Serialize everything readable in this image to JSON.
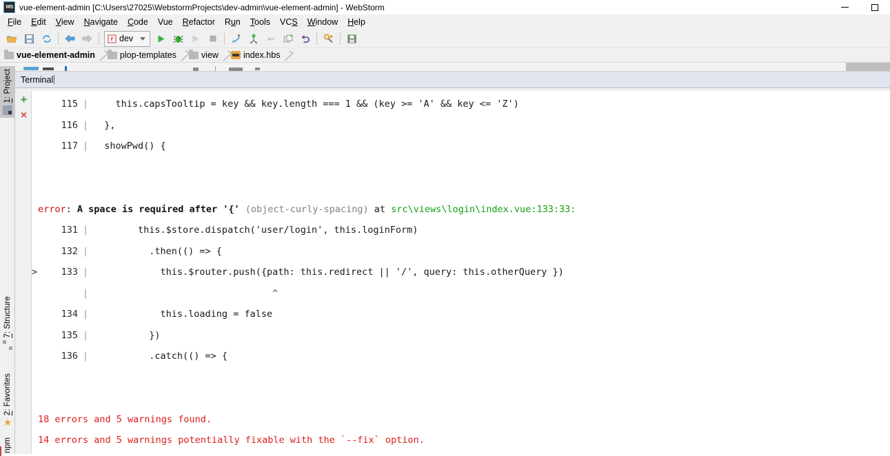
{
  "window": {
    "app_icon": "WS",
    "title": "vue-element-admin [C:\\Users\\27025\\WebstormProjects\\dev-admin\\vue-element-admin] - WebStorm",
    "controls": {
      "minimize": "minimize-button",
      "maximize": "maximize-button"
    }
  },
  "menubar": [
    {
      "label": "File",
      "mnemonic": "F"
    },
    {
      "label": "Edit",
      "mnemonic": "E"
    },
    {
      "label": "View",
      "mnemonic": "V"
    },
    {
      "label": "Navigate",
      "mnemonic": "N"
    },
    {
      "label": "Code",
      "mnemonic": "C"
    },
    {
      "label": "Vue",
      "mnemonic": ""
    },
    {
      "label": "Refactor",
      "mnemonic": "R"
    },
    {
      "label": "Run",
      "mnemonic": "u"
    },
    {
      "label": "Tools",
      "mnemonic": "T"
    },
    {
      "label": "VCS",
      "mnemonic": "S"
    },
    {
      "label": "Window",
      "mnemonic": "W"
    },
    {
      "label": "Help",
      "mnemonic": "H"
    }
  ],
  "toolbar": {
    "buttons": [
      "open-folder-icon",
      "save-all-icon",
      "synchronize-icon",
      "navigate-back-icon",
      "navigate-forward-icon"
    ],
    "run_config": {
      "name": "dev",
      "icon": "npm-icon",
      "dropdown": "chevron-down-icon"
    },
    "run_buttons": [
      "run-icon",
      "debug-icon",
      "coverage-icon",
      "stop-icon"
    ],
    "vcs_buttons": [
      "update-project-icon",
      "commit-icon",
      "push-icon",
      "compare-icon",
      "undo-icon"
    ],
    "right_buttons": [
      "settings-icon",
      "save-all-disk-icon"
    ]
  },
  "breadcrumb": [
    {
      "label": "vue-element-admin",
      "icon": "folder-icon"
    },
    {
      "label": "plop-templates",
      "icon": "folder-icon"
    },
    {
      "label": "view",
      "icon": "folder-icon"
    },
    {
      "label": "index.hbs",
      "icon": "handlebars-file-icon"
    }
  ],
  "tool_window": {
    "title": "Terminal"
  },
  "left_rail": [
    {
      "label": "1: Project",
      "mnemonic": "1",
      "icon": "project-icon",
      "active": true
    },
    {
      "label": "7: Structure",
      "mnemonic": "7",
      "icon": "structure-icon",
      "active": false
    },
    {
      "label": "2: Favorites",
      "mnemonic": "2",
      "icon": "star-icon",
      "active": false
    },
    {
      "label": "npm",
      "mnemonic": "",
      "icon": "npm-rail-icon",
      "active": false
    }
  ],
  "terminal_side_buttons": [
    {
      "name": "new-session-button",
      "glyph": "+"
    },
    {
      "name": "close-session-button",
      "glyph": "×"
    }
  ],
  "terminal": {
    "top_lines": [
      {
        "num": "115",
        "marker": "",
        "text": "    this.capsTooltip = key && key.length === 1 && (key >= 'A' && key <= 'Z')"
      },
      {
        "num": "116",
        "marker": "",
        "text": "  },"
      },
      {
        "num": "117",
        "marker": "",
        "text": "  showPwd() {"
      }
    ],
    "error": {
      "severity": "error",
      "colon": ":",
      "message": "A space is required after '{'",
      "rule": "(object-curly-spacing)",
      "at": "at",
      "path": "src\\views\\login\\index.vue:133:33:"
    },
    "error_lines": [
      {
        "num": "131",
        "marker": "",
        "text": "        this.$store.dispatch('user/login', this.loginForm)"
      },
      {
        "num": "132",
        "marker": "",
        "text": "          .then(() => {"
      },
      {
        "num": "133",
        "marker": ">",
        "text": "            this.$router.push({path: this.redirect || '/', query: this.otherQuery })"
      },
      {
        "num": "",
        "marker": "",
        "text": "                                ^"
      },
      {
        "num": "134",
        "marker": "",
        "text": "            this.loading = false"
      },
      {
        "num": "135",
        "marker": "",
        "text": "          })"
      },
      {
        "num": "136",
        "marker": "",
        "text": "          .catch(() => {"
      }
    ],
    "summary": [
      "18 errors and 5 warnings found.",
      "14 errors and 5 warnings potentially fixable with the `--fix` option."
    ]
  },
  "colors": {
    "error_red": "#cc1111",
    "summary_red": "#e01b1b",
    "path_green": "#12a112",
    "rule_gray": "#808080",
    "toolwindow_header": "#e1e5ee",
    "chrome_gray": "#f0f0f0"
  }
}
